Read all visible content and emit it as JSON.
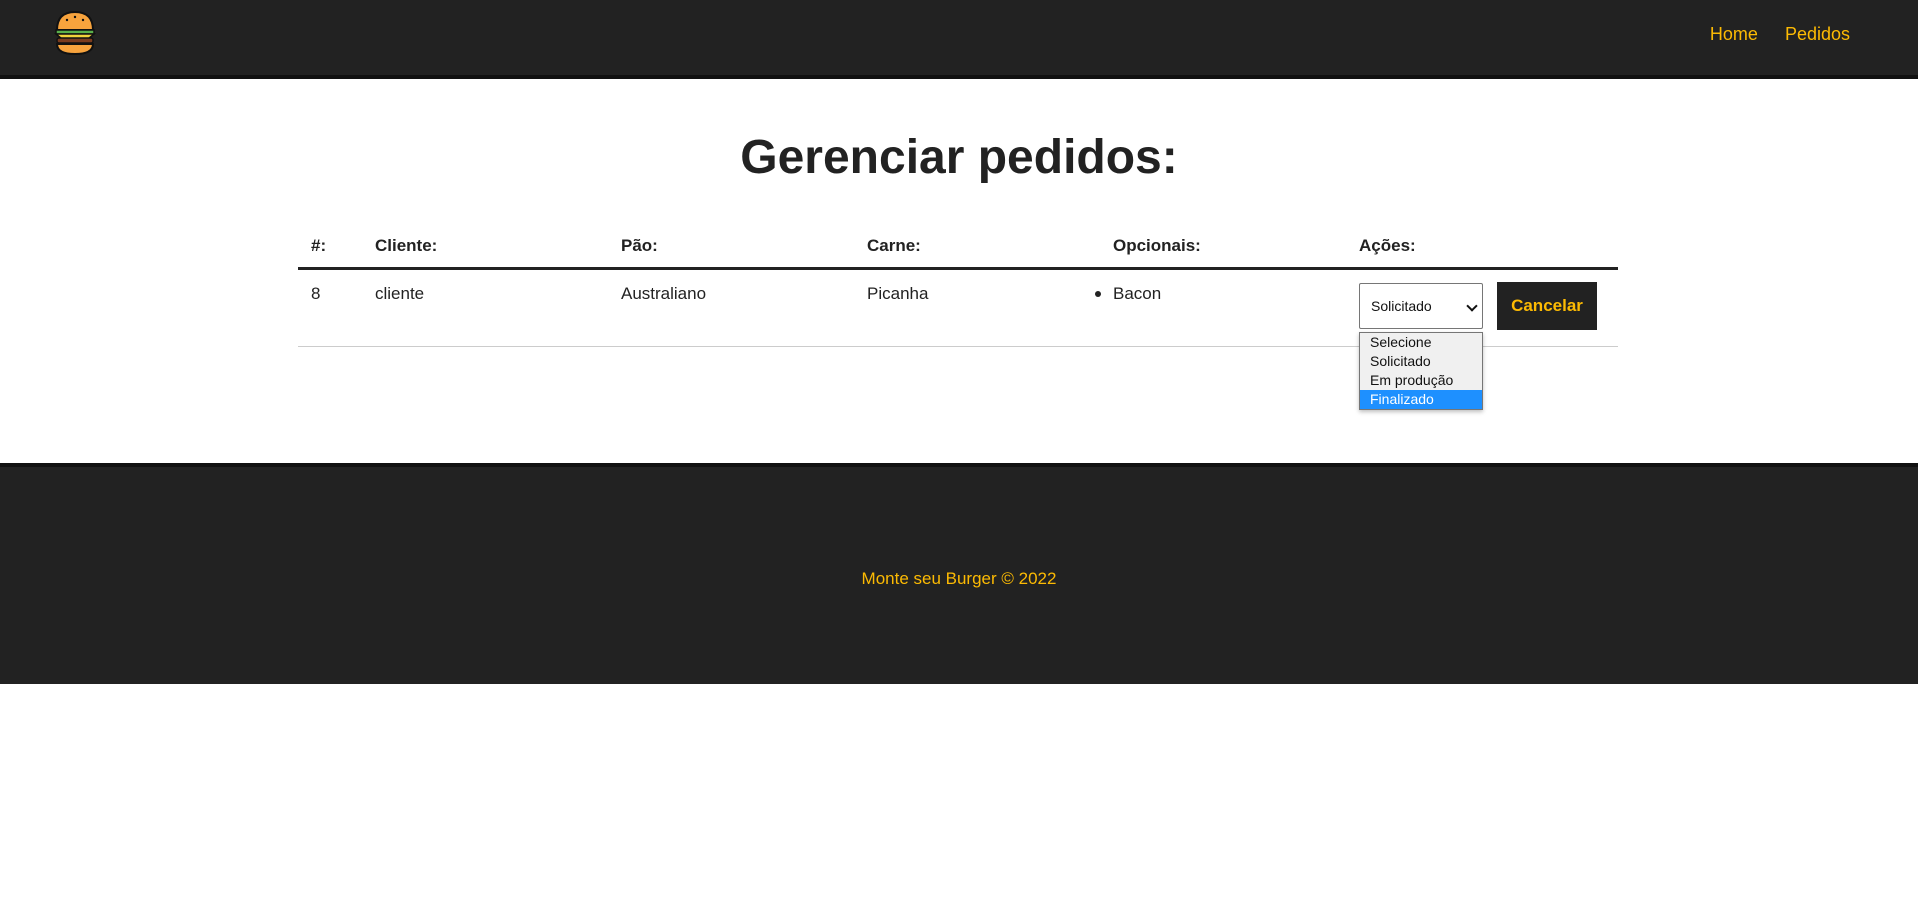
{
  "nav": {
    "logo_icon": "burger-icon",
    "links": [
      "Home",
      "Pedidos"
    ]
  },
  "page": {
    "title": "Gerenciar pedidos:"
  },
  "table": {
    "headers": [
      "#:",
      "Cliente:",
      "Pão:",
      "Carne:",
      "Opcionais:",
      "Ações:"
    ],
    "rows": [
      {
        "id": "8",
        "cliente": "cliente",
        "pao": "Australiano",
        "carne": "Picanha",
        "opcionais": [
          "Bacon"
        ],
        "status_selected": "Solicitado",
        "cancel_label": "Cancelar"
      }
    ]
  },
  "status_dropdown": {
    "options": [
      "Selecione",
      "Solicitado",
      "Em produção",
      "Finalizado"
    ],
    "highlighted": "Finalizado"
  },
  "footer": {
    "text": "Monte seu Burger © 2022"
  },
  "colors": {
    "dark": "#222222",
    "accent": "#fcba03",
    "highlight": "#1e90ff"
  }
}
